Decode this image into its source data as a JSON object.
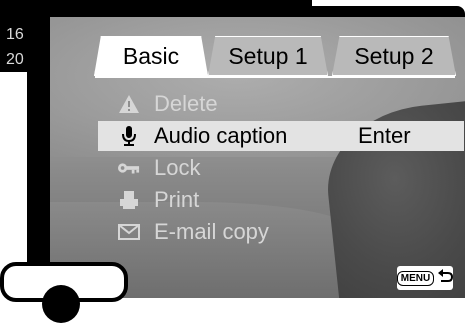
{
  "background_numbers": [
    "16",
    "20"
  ],
  "tabs": [
    {
      "label": "Basic",
      "active": true
    },
    {
      "label": "Setup 1",
      "active": false
    },
    {
      "label": "Setup 2",
      "active": false
    }
  ],
  "menu": {
    "items": [
      {
        "label": "Delete",
        "icon": "warning-icon",
        "enabled": false,
        "selected": false,
        "value": ""
      },
      {
        "label": "Audio caption",
        "icon": "microphone-icon",
        "enabled": true,
        "selected": true,
        "value": "Enter"
      },
      {
        "label": "Lock",
        "icon": "key-icon",
        "enabled": false,
        "selected": false,
        "value": ""
      },
      {
        "label": "Print",
        "icon": "print-icon",
        "enabled": false,
        "selected": false,
        "value": ""
      },
      {
        "label": "E-mail copy",
        "icon": "envelope-icon",
        "enabled": false,
        "selected": false,
        "value": ""
      }
    ]
  },
  "menu_button": {
    "label": "MENU",
    "icon": "return-arrow-icon"
  },
  "colors": {
    "selected_row": "#e3e3e3",
    "dim_text": "#d6d6d6",
    "tab_inactive": "#b9b9b9"
  }
}
